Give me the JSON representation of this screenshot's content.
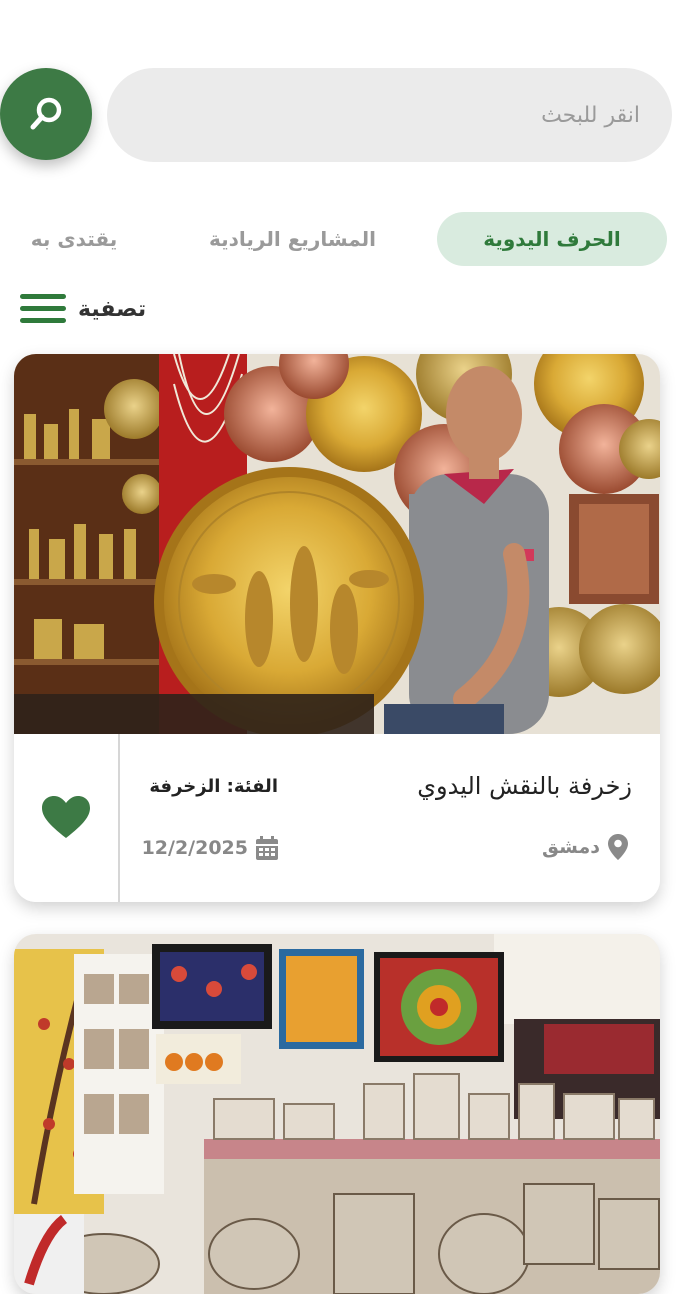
{
  "search": {
    "placeholder": "انقر للبحث",
    "icon": "search-icon"
  },
  "tabs": [
    {
      "label": "الحرف اليدوية",
      "active": true
    },
    {
      "label": "المشاريع الريادية",
      "active": false
    },
    {
      "label": "يقتدى به",
      "active": false
    }
  ],
  "filter": {
    "label": "تصفية",
    "icon": "menu-icon"
  },
  "colors": {
    "accent": "#3d7a45",
    "active_tab_bg": "#d9ebdf",
    "active_tab_text": "#2f7a3b",
    "search_bg": "#ebebeb"
  },
  "cards": [
    {
      "title": "زخرفة بالنقش اليدوي",
      "category": "الفئة: الزخرفة",
      "location": "دمشق",
      "date": "12/2/2025",
      "favorited": true,
      "image": "photo of craftsman holding engraved brass plate"
    },
    {
      "image": "photo of handicraft exhibition with tapestries and inlaid boxes"
    }
  ]
}
